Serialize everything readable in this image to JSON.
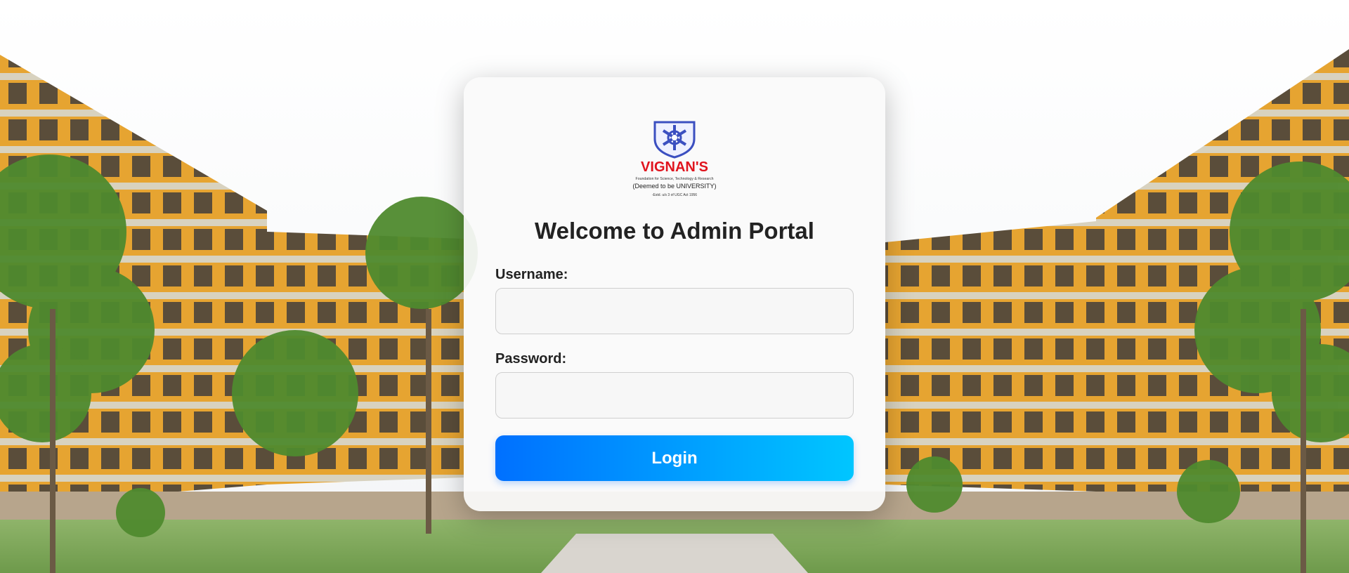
{
  "login_card": {
    "logo": {
      "brand": "VIGNAN'S",
      "line1": "Foundation for Science, Technology & Research",
      "line2": "(Deemed to be UNIVERSITY)",
      "line3": "-Estd. u/s 3 of UGC Act 1956",
      "icon": "university-shield-icon"
    },
    "title": "Welcome to Admin Portal",
    "username_label": "Username:",
    "username_value": "",
    "password_label": "Password:",
    "password_value": "",
    "login_label": "Login"
  },
  "colors": {
    "button_gradient_start": "#0070ff",
    "button_gradient_end": "#00c6ff",
    "brand_red": "#e0141e",
    "shield_blue": "#3b4fc0",
    "building_orange": "#e3a02c"
  }
}
